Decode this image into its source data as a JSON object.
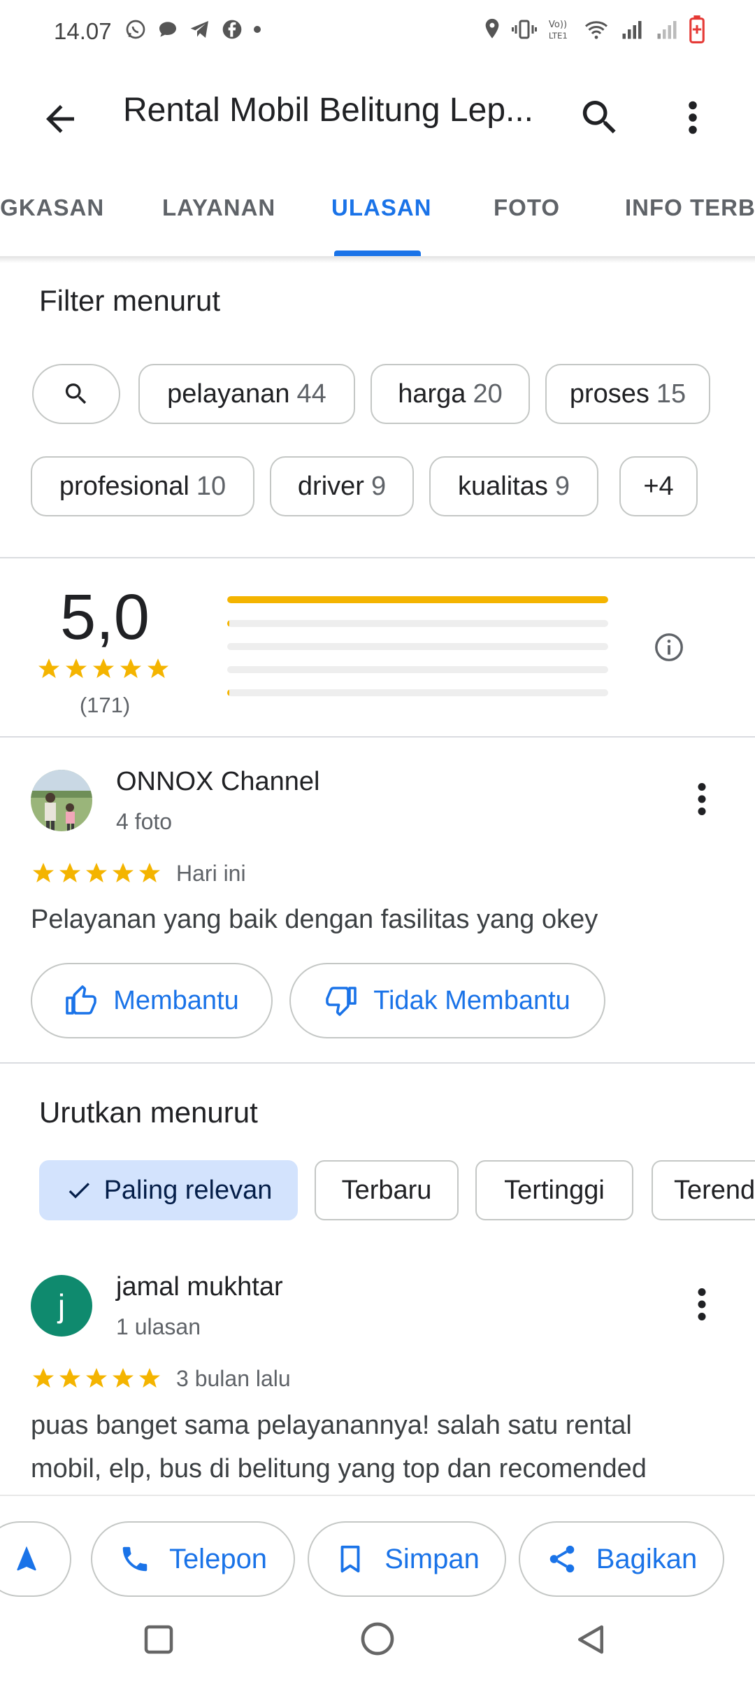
{
  "status_bar": {
    "time": "14.07"
  },
  "app_bar": {
    "title": "Rental Mobil Belitung Lep..."
  },
  "tabs": [
    {
      "label": "IGKASAN"
    },
    {
      "label": "LAYANAN"
    },
    {
      "label": "ULASAN"
    },
    {
      "label": "FOTO"
    },
    {
      "label": "INFO TERBA"
    }
  ],
  "filter": {
    "title": "Filter menurut",
    "chips": [
      {
        "label": "pelayanan",
        "count": "44"
      },
      {
        "label": "harga",
        "count": "20"
      },
      {
        "label": "proses",
        "count": "15"
      },
      {
        "label": "profesional",
        "count": "10"
      },
      {
        "label": "driver",
        "count": "9"
      },
      {
        "label": "kualitas",
        "count": "9"
      },
      {
        "label": "+4",
        "count": ""
      }
    ]
  },
  "rating_summary": {
    "score": "5,0",
    "total": "(171)",
    "distribution": [
      {
        "stars": 5,
        "fraction": 1.0
      },
      {
        "stars": 4,
        "fraction": 0.005
      },
      {
        "stars": 3,
        "fraction": 0.0
      },
      {
        "stars": 2,
        "fraction": 0.0
      },
      {
        "stars": 1,
        "fraction": 0.005
      }
    ]
  },
  "reviews": [
    {
      "name": "ONNOX Channel",
      "meta": "4 foto",
      "date": "Hari ini",
      "rating": 5,
      "text": "Pelayanan yang baik dengan fasilitas yang okey",
      "helpful_label": "Membantu",
      "not_helpful_label": "Tidak Membantu"
    },
    {
      "name": "jamal mukhtar",
      "avatar_letter": "j",
      "meta": "1 ulasan",
      "date": "3 bulan lalu",
      "rating": 5,
      "text_line1": "puas banget sama pelayanannya! salah satu rental",
      "text_line2": "mobil, elp, bus di belitung yang top dan recomended"
    }
  ],
  "sort": {
    "title": "Urutkan menurut",
    "options": [
      {
        "label": "Paling relevan",
        "selected": true
      },
      {
        "label": "Terbaru",
        "selected": false
      },
      {
        "label": "Tertinggi",
        "selected": false
      },
      {
        "label": "Terend",
        "selected": false
      }
    ]
  },
  "actions": {
    "call": "Telepon",
    "save": "Simpan",
    "share": "Bagikan"
  },
  "colors": {
    "accent": "#1a73e8",
    "star": "#f4b400",
    "selected_chip": "#d3e3fd",
    "avatar_j": "#0f8a6e"
  }
}
